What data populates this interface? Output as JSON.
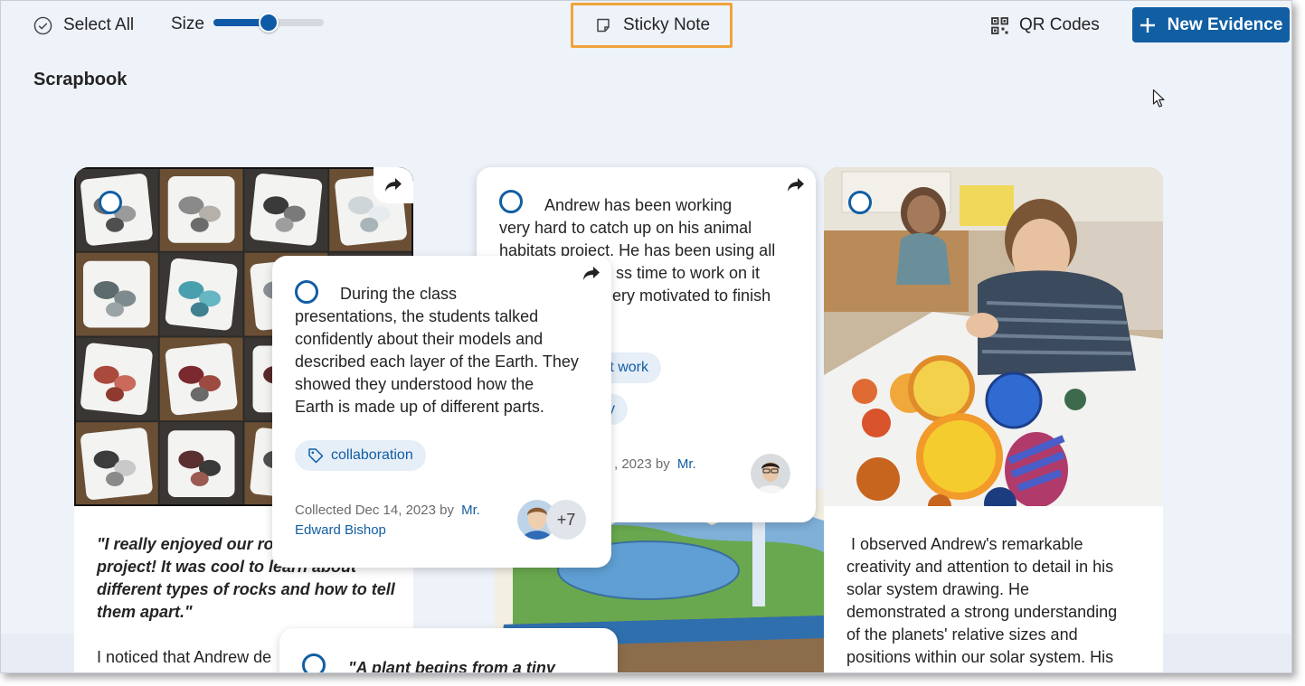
{
  "toolbar": {
    "select_all": "Select All",
    "size_label": "Size",
    "size_value": 0.5,
    "sticky_note": "Sticky Note",
    "qr_codes": "QR Codes",
    "new_evidence": "New Evidence"
  },
  "section_title": "Scrapbook",
  "cards": {
    "rocks": {
      "quote_line1": "\"I really enjoyed our ro",
      "quote_line2": "project! It was cool to learn about",
      "quote_line3": "different types of rocks and how to tell",
      "quote_line4": "them apart.\"",
      "body_line1": "I noticed that Andrew de"
    },
    "habitats": {
      "line1": "Andrew has been working",
      "line2": "very hard to catch up on his animal",
      "line3": "habitats project. He has been using all",
      "line4": "ss time to work on it",
      "line5": "ery motivated to finish",
      "tag1": "t work",
      "tag2": "y",
      "meta_date": ", 2023  by",
      "meta_author": "Mr."
    },
    "earth": {
      "line1": "During the class",
      "line2": "presentations, the students talked",
      "line3": "confidently about their models and",
      "line4": "described each layer of the Earth. They",
      "line5": "showed they understood how the",
      "line6": "Earth is made up of different parts.",
      "tag": "collaboration",
      "meta_collected": "Collected Dec 14, 2023  by",
      "meta_author_1": "Mr.",
      "meta_author_2": "Edward Bishop",
      "more_count": "+7"
    },
    "solar": {
      "line1": " I observed Andrew's remarkable",
      "line2": "creativity and attention to detail in his",
      "line3": "solar system drawing. He",
      "line4": "demonstrated a strong understanding",
      "line5": "of the planets' relative sizes and",
      "line6": "positions within our solar system. His"
    },
    "plant": {
      "line1": "\"A plant begins from a tiny"
    }
  },
  "colors": {
    "accent": "#115ea3",
    "highlight": "#f0a33b",
    "background": "#eef2f9"
  }
}
